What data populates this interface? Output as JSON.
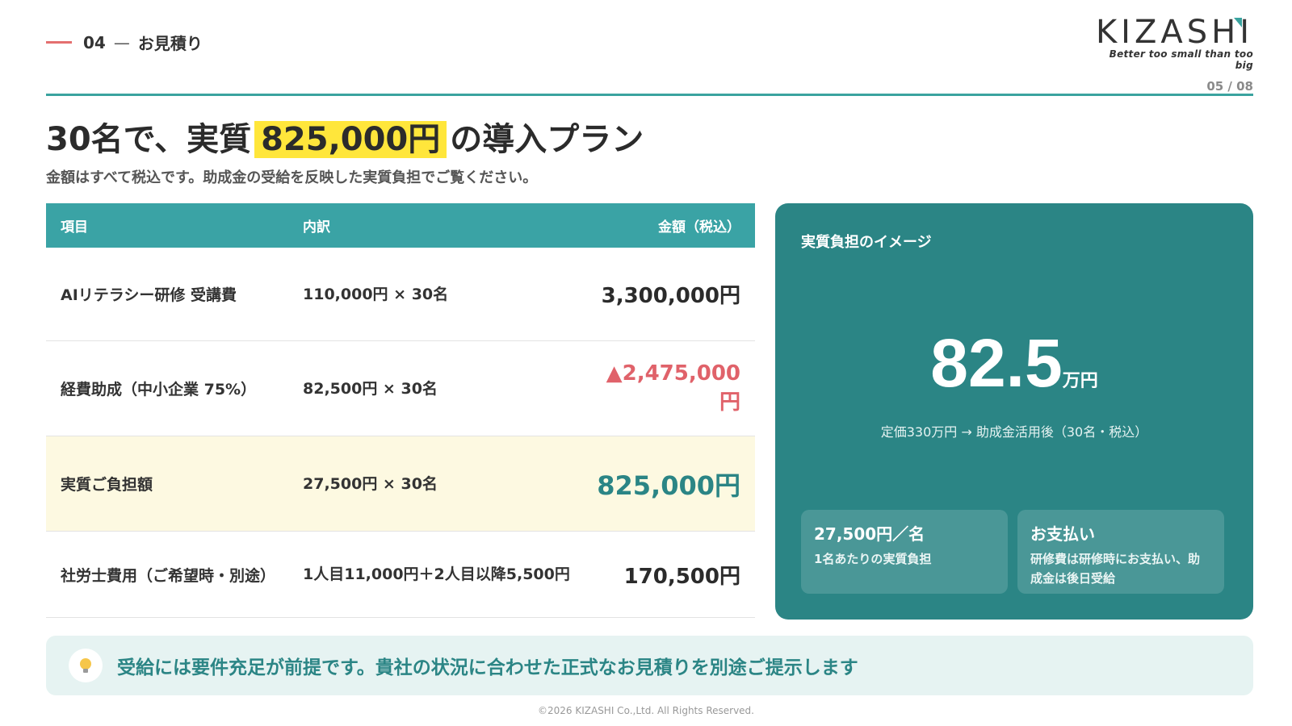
{
  "header": {
    "section_number": "04",
    "section_title": "お見積り",
    "logo_text": "KIZASHI",
    "logo_tagline": "Better too small than too big",
    "page_number": "05 / 08"
  },
  "headline": {
    "prefix": "30名で、実質",
    "highlight": "825,000円",
    "suffix": "の導入プラン"
  },
  "subline": "金額はすべて税込です。助成金の受給を反映した実質負担でご覧ください。",
  "table": {
    "headers": [
      "項目",
      "内訳",
      "金額（税込）"
    ],
    "rows": [
      {
        "item": "AIリテラシー研修 受講費",
        "detail": "110,000円 × 30名",
        "amount": "3,300,000円"
      },
      {
        "item": "経費助成（中小企業 75%）",
        "detail": "82,500円 × 30名",
        "amount": "▲2,475,000円"
      },
      {
        "item": "実質ご負担額",
        "detail": "27,500円 × 30名",
        "amount": "825,000円"
      },
      {
        "item": "社労士費用（ご希望時・別途）",
        "detail": "1人目11,000円＋2人目以降5,500円",
        "amount": "170,500円"
      }
    ]
  },
  "panel": {
    "title": "実質負担のイメージ",
    "big_value": "82.5",
    "big_unit": "万円",
    "caption": "定価330万円 → 助成金活用後（30名・税込）",
    "cards": [
      {
        "title": "27,500円／名",
        "text": "1名あたりの実質負担"
      },
      {
        "title": "お支払い",
        "text": "研修費は研修時にお支払い、助成金は後日受給"
      }
    ]
  },
  "notice": "受給には要件充足が前提です。貴社の状況に合わせた正式なお見積りを別途ご提示します",
  "footer": "©2026 KIZASHI Co.,Ltd. All Rights Reserved.",
  "colors": {
    "accent_teal": "#3aa3a5",
    "panel_teal": "#2b8585",
    "highlight_yellow": "#ffe63b",
    "red": "#e0626a",
    "section_bar": "#e46f6f"
  }
}
